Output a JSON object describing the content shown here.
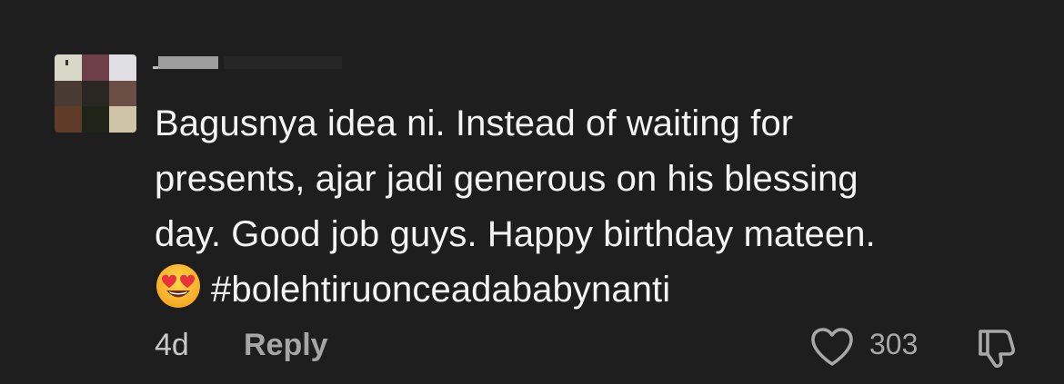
{
  "comment": {
    "avatar_colors": [
      "#d8d8c8",
      "#6e3f48",
      "#dfdfe4",
      "#4a3a34",
      "#2a2622",
      "#6b4f44",
      "#5e3c28",
      "#1f2418",
      "#cfc4a8"
    ],
    "text_lines": [
      "Bagusnya idea ni. Instead of waiting for",
      "presents, ajar jadi generous on his blessing",
      "day. Good job guys. Happy birthday mateen."
    ],
    "hashtag": "#bolehtiruonceadababynanti",
    "emoji": "smiling-face-with-heart-eyes-icon",
    "timestamp": "4d",
    "reply_label": "Reply",
    "like_count": "303",
    "icons": {
      "like": "heart-icon",
      "dislike": "thumbs-down-icon"
    }
  }
}
